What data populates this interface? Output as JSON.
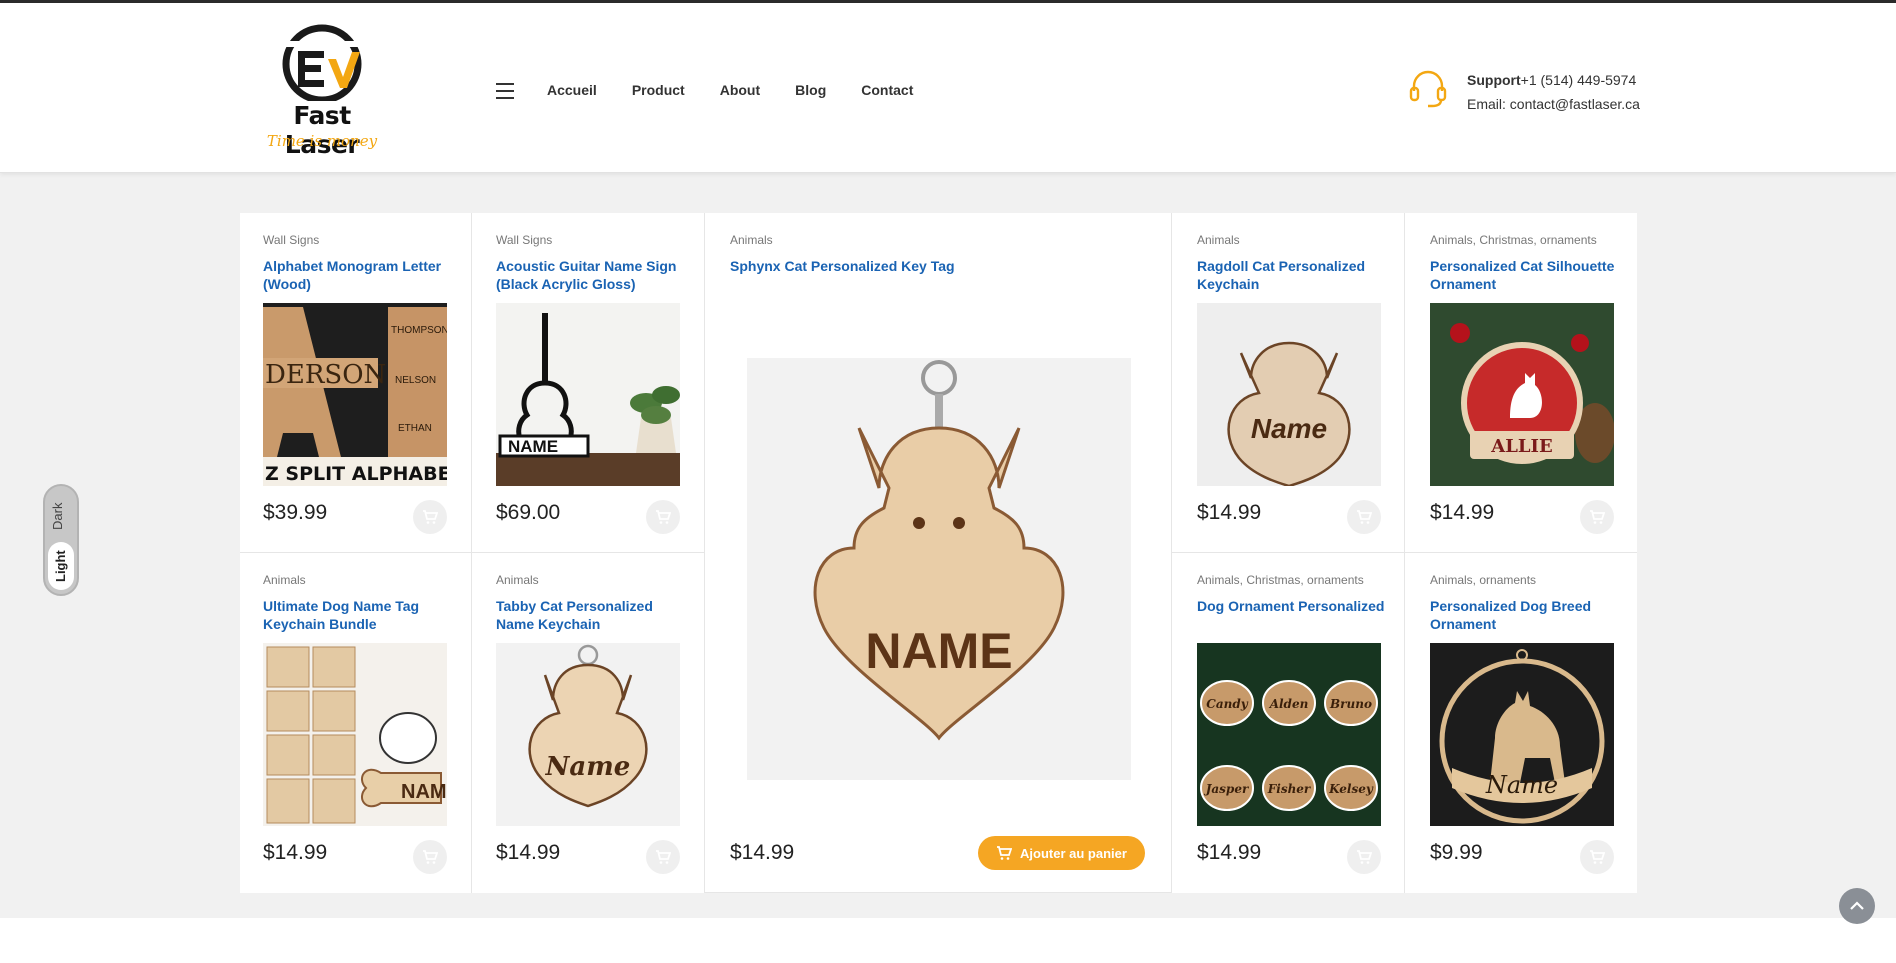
{
  "header": {
    "logo_text": "Fast Laser",
    "logo_tagline": "Time is money",
    "nav": [
      "Accueil",
      "Product",
      "About",
      "Blog",
      "Contact"
    ],
    "support_label": "Support",
    "support_phone": "+1 (514) 449-5974",
    "support_email": "Email: contact@fastlaser.ca"
  },
  "theme": {
    "dark": "Dark",
    "light": "Light"
  },
  "products": [
    {
      "category": "Wall Signs",
      "title": "Alphabet Monogram Letter (Wood)",
      "price": "$39.99"
    },
    {
      "category": "Wall Signs",
      "title": "Acoustic Guitar Name Sign (Black Acrylic Gloss)",
      "price": "$69.00"
    },
    {
      "category": "Animals",
      "title": "Sphynx Cat Personalized Key Tag",
      "price": "$14.99",
      "button": "Ajouter au panier",
      "image_text": "NAME"
    },
    {
      "category": "Animals",
      "title": "Ragdoll Cat Personalized Keychain",
      "price": "$14.99",
      "image_text": "Name"
    },
    {
      "category": "Animals, Christmas, ornaments",
      "title": "Personalized Cat Silhouette Ornament",
      "price": "$14.99",
      "image_text": "ALLIE"
    },
    {
      "category": "Animals",
      "title": "Ultimate Dog Name Tag Keychain Bundle",
      "price": "$14.99"
    },
    {
      "category": "Animals",
      "title": "Tabby Cat Personalized Name Keychain",
      "price": "$14.99",
      "image_text": "Name"
    },
    {
      "category": "Animals, Christmas, ornaments",
      "title": "Dog Ornament Personalized",
      "price": "$14.99",
      "image_names": [
        "Candy",
        "Alden",
        "Bruno",
        "Jasper",
        "Fisher",
        "Kelsey"
      ]
    },
    {
      "category": "Animals, ornaments",
      "title": "Personalized Dog Breed Ornament",
      "price": "$9.99",
      "image_text": "Name"
    }
  ],
  "image_texts": {
    "monogram": [
      "DERSON",
      "Z SPLIT ALPHABET LET",
      "THOMPSON",
      "NELSON",
      "ETHAN"
    ],
    "guitar": "NAME"
  },
  "colors": {
    "accent": "#f5a623",
    "link": "#1a63b3"
  }
}
